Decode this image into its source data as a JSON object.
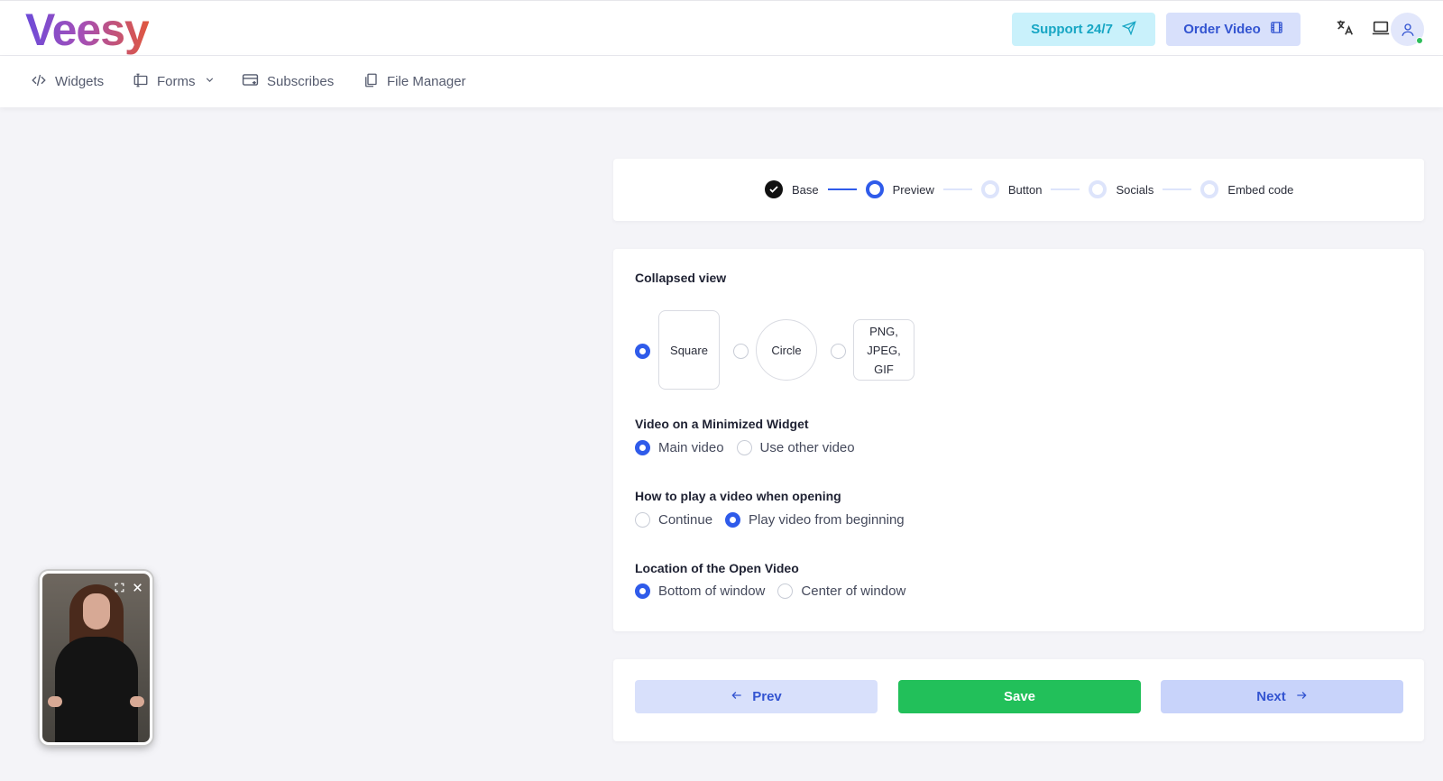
{
  "header": {
    "logo_text": "Veesy",
    "support_label": "Support 24/7",
    "order_label": "Order Video"
  },
  "nav": {
    "items": [
      {
        "label": "Widgets",
        "icon": "code-icon"
      },
      {
        "label": "Forms",
        "icon": "form-icon",
        "dropdown": true
      },
      {
        "label": "Subscribes",
        "icon": "card-icon"
      },
      {
        "label": "File Manager",
        "icon": "files-icon"
      }
    ]
  },
  "stepper": {
    "steps": [
      {
        "label": "Base",
        "state": "done"
      },
      {
        "label": "Preview",
        "state": "active"
      },
      {
        "label": "Button",
        "state": "todo"
      },
      {
        "label": "Socials",
        "state": "todo"
      },
      {
        "label": "Embed code",
        "state": "todo"
      }
    ]
  },
  "settings": {
    "collapsed_view": {
      "title": "Collapsed view",
      "options": [
        {
          "label": "Square",
          "selected": true
        },
        {
          "label": "Circle",
          "selected": false
        },
        {
          "label": "PNG, JPEG, GIF",
          "lines": [
            "PNG,",
            "JPEG,",
            "GIF"
          ],
          "selected": false
        }
      ]
    },
    "minimized_video": {
      "title": "Video on a Minimized Widget",
      "options": [
        {
          "label": "Main video",
          "selected": true
        },
        {
          "label": "Use other video",
          "selected": false
        }
      ]
    },
    "play_mode": {
      "title": "How to play a video when opening",
      "options": [
        {
          "label": "Continue",
          "selected": false
        },
        {
          "label": "Play video from beginning",
          "selected": true
        }
      ]
    },
    "location": {
      "title": "Location of the Open Video",
      "options": [
        {
          "label": "Bottom of window",
          "selected": true
        },
        {
          "label": "Center of window",
          "selected": false
        }
      ]
    }
  },
  "actions": {
    "prev_label": "Prev",
    "save_label": "Save",
    "next_label": "Next"
  },
  "colors": {
    "accent": "#2f5bea",
    "save": "#22c05a",
    "support_bg": "#c9f1fb",
    "order_bg": "#d8e0fb"
  }
}
